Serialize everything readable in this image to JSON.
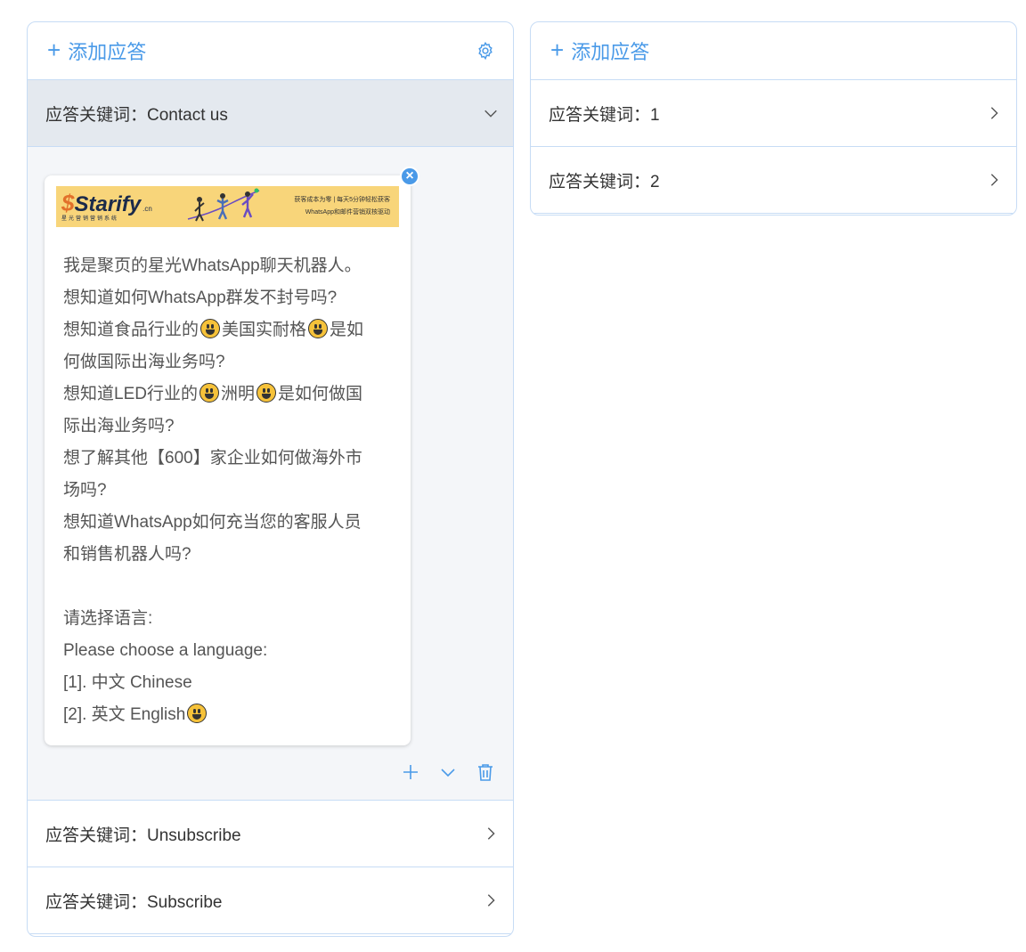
{
  "left_panel": {
    "add_label": "添加应答",
    "items": [
      {
        "label": "应答关键词：Contact us",
        "expanded": true
      },
      {
        "label": "应答关键词：Unsubscribe",
        "expanded": false
      },
      {
        "label": "应答关键词：Subscribe",
        "expanded": false
      }
    ],
    "message": {
      "banner": {
        "brand_name": "Starify",
        "brand_suffix": ".cn",
        "brand_sub": "星光营销营销系统",
        "line1": "获客成本为零 | 每天5分钟轻松获客",
        "line2": "WhatsApp和邮件营销双核驱动"
      },
      "lines": [
        "我是聚页的星光WhatsApp聊天机器人。",
        "想知道如何WhatsApp群发不封号吗?",
        "想知道食品行业的",
        "美国实耐格",
        "是如",
        "何做国际出海业务吗?",
        "想知道LED行业的",
        "洲明",
        "是如何做国",
        "际出海业务吗?",
        "想了解其他【600】家企业如何做海外市",
        "场吗?",
        "想知道WhatsApp如何充当您的客服人员",
        "和销售机器人吗?",
        "请选择语言:",
        "Please choose a language:",
        "[1]. 中文 Chinese",
        "[2]. 英文 English"
      ]
    }
  },
  "right_panel": {
    "add_label": "添加应答",
    "items": [
      {
        "label": "应答关键词：1"
      },
      {
        "label": "应答关键词：2"
      }
    ]
  },
  "colors": {
    "accent": "#4a9ae8",
    "border": "#c7dcf5",
    "active_row": "#e4e9ef",
    "expanded_bg": "#f4f6f9",
    "banner": "#f8d57a"
  },
  "icons": [
    "plus-icon",
    "gear-icon",
    "chevron-down-icon",
    "chevron-right-icon",
    "close-icon",
    "trash-icon",
    "grinning-emoji-icon"
  ]
}
